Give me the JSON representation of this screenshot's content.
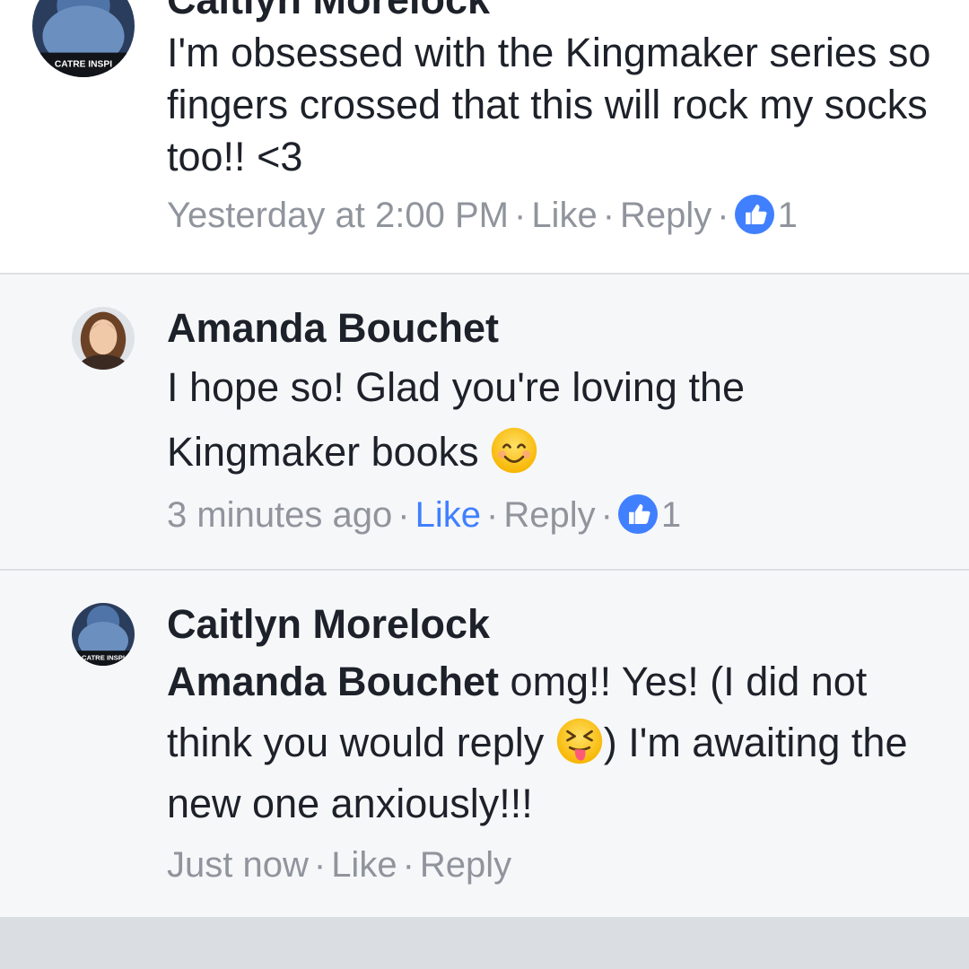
{
  "comments": [
    {
      "author": "Caitlyn Morelock",
      "avatar_caption": "CATRE INSPI",
      "text": "I'm obsessed with the Kingmaker series so fingers crossed that this will rock my socks too!! <3",
      "timestamp": "Yesterday at 2:00 PM",
      "like_label": "Like",
      "reply_label": "Reply",
      "reaction_count": "1"
    },
    {
      "author": "Amanda Bouchet",
      "text": "I hope so! Glad you're loving the Kingmaker books",
      "emoji": "smiling-face-emoji",
      "timestamp": "3 minutes ago",
      "like_label": "Like",
      "reply_label": "Reply",
      "reaction_count": "1"
    },
    {
      "author": "Caitlyn Morelock",
      "avatar_caption": "CATRE INSPI",
      "mention": "Amanda Bouchet",
      "text_part1": " omg!! Yes! (I did not think you would reply ",
      "emoji": "squinting-tongue-emoji",
      "text_part2": ") I'm awaiting the new one anxiously!!!",
      "timestamp": "Just now",
      "like_label": "Like",
      "reply_label": "Reply"
    }
  ],
  "separator": "·",
  "colors": {
    "text": "#1d2129",
    "meta": "#90949c",
    "liked": "#4080ff",
    "reply_bg": "#f6f7f9",
    "divider": "#dddfe2"
  }
}
